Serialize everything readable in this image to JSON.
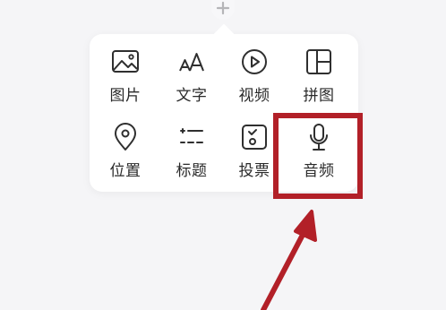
{
  "menu": {
    "items": [
      {
        "label": "图片",
        "icon": "image-icon"
      },
      {
        "label": "文字",
        "icon": "text-icon"
      },
      {
        "label": "视频",
        "icon": "video-play-icon"
      },
      {
        "label": "拼图",
        "icon": "collage-icon"
      },
      {
        "label": "位置",
        "icon": "location-pin-icon"
      },
      {
        "label": "标题",
        "icon": "title-icon"
      },
      {
        "label": "投票",
        "icon": "vote-icon"
      },
      {
        "label": "音频",
        "icon": "microphone-icon"
      }
    ]
  },
  "annotation": {
    "highlight_color": "#b22028",
    "highlighted_item": "音频"
  }
}
